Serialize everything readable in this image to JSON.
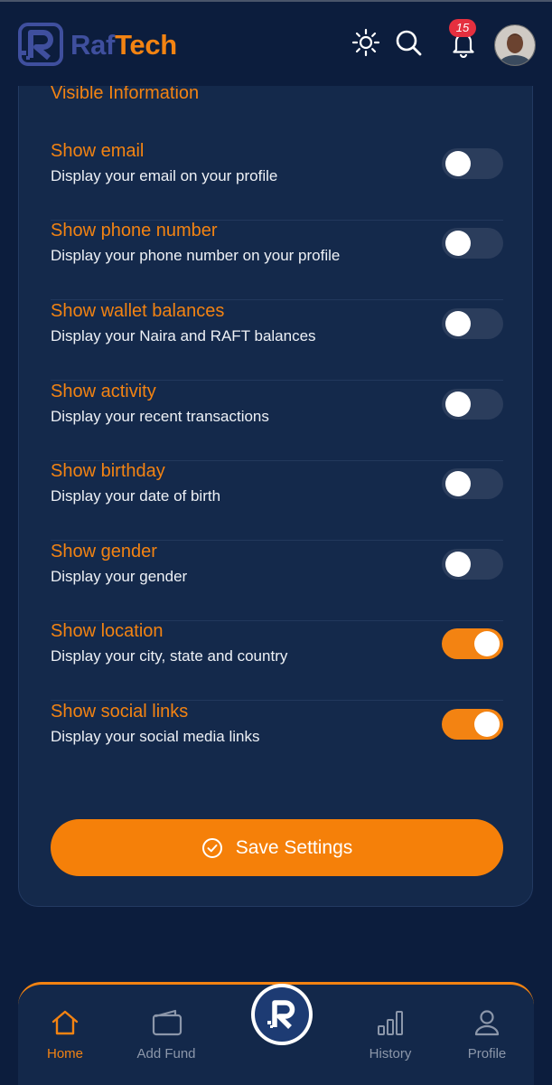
{
  "app": {
    "brand_part1": "Raf",
    "brand_part2": "Tech",
    "notification_count": "15"
  },
  "colors": {
    "accent": "#f38312",
    "background": "#0c1d3d",
    "card": "#14294b",
    "toggle_off": "#2b3d5c"
  },
  "header": {
    "icons": [
      "sun-icon",
      "search-icon",
      "bell-icon"
    ]
  },
  "section": {
    "title": "Visible Information"
  },
  "settings": [
    {
      "title": "Show email",
      "description": "Display your email on your profile",
      "enabled": false
    },
    {
      "title": "Show phone number",
      "description": "Display your phone number on your profile",
      "enabled": false
    },
    {
      "title": "Show wallet balances",
      "description": "Display your Naira and RAFT balances",
      "enabled": false
    },
    {
      "title": "Show activity",
      "description": "Display your recent transactions",
      "enabled": false
    },
    {
      "title": "Show birthday",
      "description": "Display your date of birth",
      "enabled": false
    },
    {
      "title": "Show gender",
      "description": "Display your gender",
      "enabled": false
    },
    {
      "title": "Show location",
      "description": "Display your city, state and country",
      "enabled": true
    },
    {
      "title": "Show social links",
      "description": "Display your social media links",
      "enabled": true
    }
  ],
  "actions": {
    "save_label": "Save Settings"
  },
  "nav": {
    "items": [
      {
        "label": "Home",
        "icon": "home-icon",
        "active": true
      },
      {
        "label": "Add Fund",
        "icon": "wallet-icon",
        "active": false
      },
      {
        "label": "History",
        "icon": "bar-chart-icon",
        "active": false
      },
      {
        "label": "Profile",
        "icon": "user-icon",
        "active": false
      }
    ]
  }
}
